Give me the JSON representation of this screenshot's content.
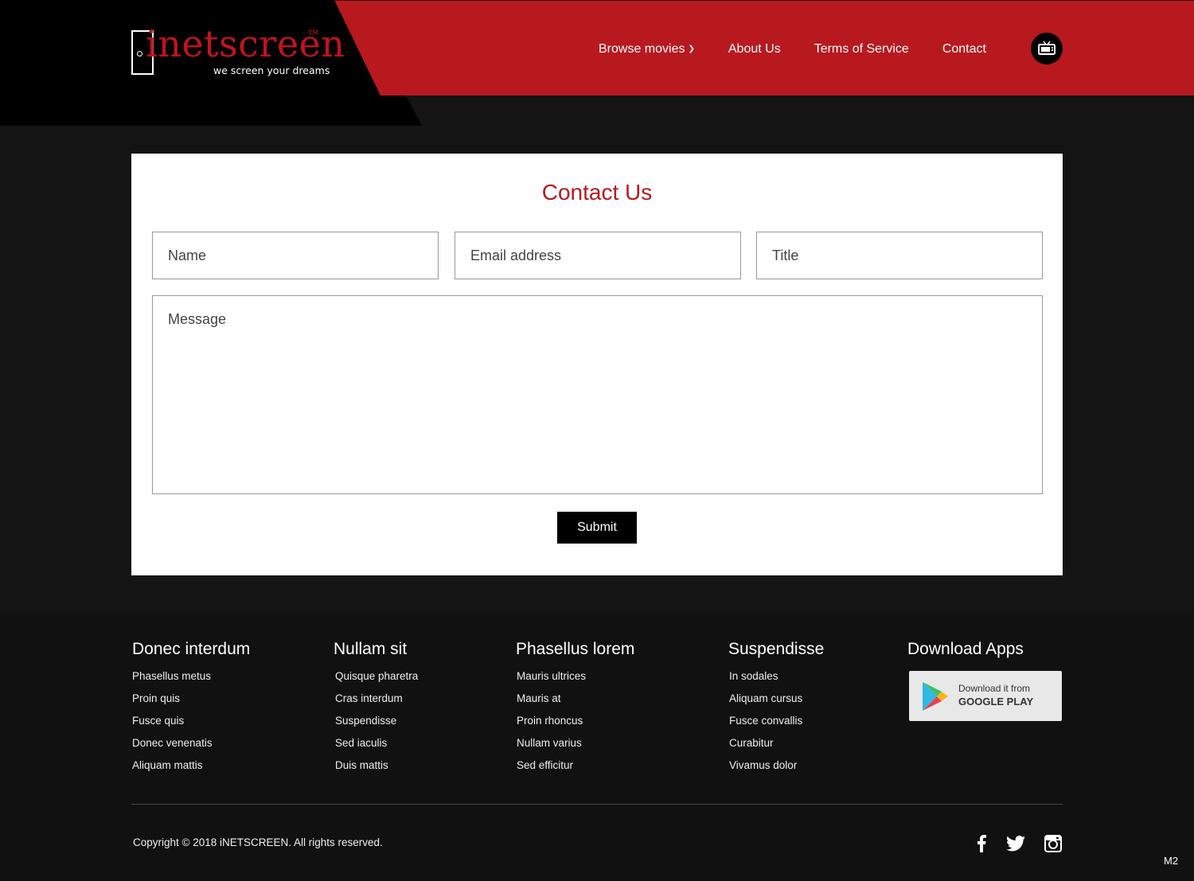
{
  "brand": {
    "name": "inetscreen",
    "tagline": "we screen your dreams",
    "tm": "TM",
    "accent_color": "#b7191f"
  },
  "nav": {
    "items": [
      {
        "label": "Browse movies",
        "has_dropdown": true
      },
      {
        "label": "About Us"
      },
      {
        "label": "Terms of Service"
      },
      {
        "label": "Contact"
      }
    ],
    "tv_icon": "tv-icon"
  },
  "contact": {
    "title": "Contact Us",
    "name_placeholder": "Name",
    "email_placeholder": "Email address",
    "title_placeholder": "Title",
    "message_placeholder": "Message",
    "submit_label": "Submit"
  },
  "footer": {
    "columns": [
      {
        "heading": "Donec interdum",
        "links": [
          "Phasellus metus",
          "Proin quis",
          "Fusce quis",
          "Donec venenatis",
          "Aliquam mattis"
        ]
      },
      {
        "heading": "Nullam sit",
        "links": [
          "Quisque pharetra",
          "Cras interdum",
          "Suspendisse",
          "Sed iaculis",
          "Duis mattis"
        ]
      },
      {
        "heading": "Phasellus lorem",
        "links": [
          "Mauris ultrices",
          "Mauris at",
          "Proin rhoncus",
          "Nullam varius",
          "Sed efficitur"
        ]
      },
      {
        "heading": "Suspendisse",
        "links": [
          "In sodales",
          "Aliquam cursus",
          "Fusce convallis",
          "Curabitur",
          "Vivamus dolor"
        ]
      }
    ],
    "apps": {
      "heading": "Download Apps",
      "badge_line1": "Download it from",
      "badge_line2": "GOOGLE PLAY",
      "badge_icon": "google-play-icon"
    },
    "copyright": "Copyright ©  2018  iNETSCREEN.   All rights reserved.",
    "social": [
      "facebook-icon",
      "twitter-icon",
      "instagram-icon"
    ],
    "corner_label": "M2"
  }
}
